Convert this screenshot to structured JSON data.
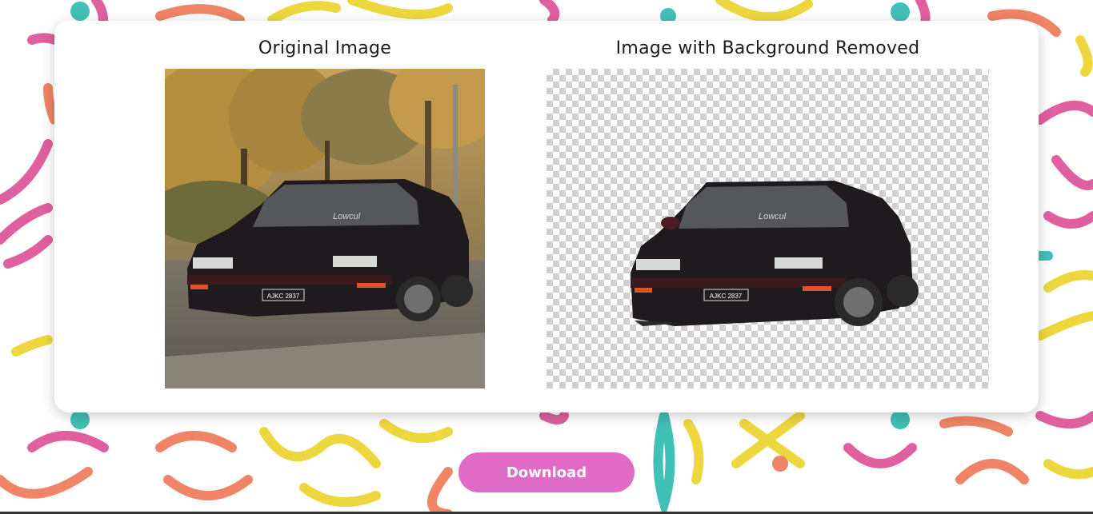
{
  "page": {
    "original_title": "Original Image",
    "removed_title": "Image with Background Removed",
    "download_label": "Download",
    "plate_text": "AJKC 2837",
    "windshield_text": "Lowcul"
  },
  "colors": {
    "button": "#e06bc6",
    "doodle_pink": "#e0609f",
    "doodle_yellow": "#ecd83e",
    "doodle_teal": "#41c0b6",
    "doodle_orange": "#ef8466"
  }
}
